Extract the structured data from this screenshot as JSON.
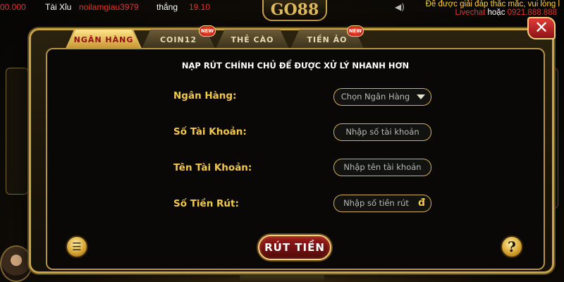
{
  "ticker": {
    "amount": "00.000",
    "game": "Tài Xỉu",
    "user": "noilamgiau3979",
    "word": "thắng",
    "amount2": "19.10"
  },
  "logo": {
    "text": "GO88"
  },
  "support": {
    "help_text": "Để được giải đáp thắc mắc, vui lòng l",
    "livechat": "Livechat",
    "or": " hoặc ",
    "phone": "0921.888.888"
  },
  "modal": {
    "close_label": "✕",
    "tabs": [
      {
        "label": "NGÂN HÀNG",
        "active": true,
        "new": false
      },
      {
        "label": "COIN12",
        "active": false,
        "new": true
      },
      {
        "label": "THẺ CÀO",
        "active": false,
        "new": false
      },
      {
        "label": "TIỀN ẢO",
        "active": false,
        "new": true
      }
    ],
    "new_badge": "NEW",
    "title": "NẠP RÚT CHÍNH CHỦ ĐỂ ĐƯỢC XỬ LÝ NHANH HƠN",
    "fields": {
      "bank": {
        "label": "Ngân Hàng:",
        "value": "Chọn Ngân Hàng"
      },
      "account_number": {
        "label": "Số Tài Khoản:",
        "placeholder": "Nhập số tài  khoản"
      },
      "account_name": {
        "label": "Tên Tài Khoản:",
        "placeholder": "Nhập tên tài khoản"
      },
      "amount": {
        "label": "Số Tiền Rút:",
        "placeholder": "Nhập số tiền rút",
        "currency": "đ"
      }
    },
    "withdraw_button": "RÚT TIỀN",
    "help_glyph": "?",
    "list_glyph": "☰"
  },
  "colors": {
    "accent_gold": "#f1c94a",
    "active_tab_text": "#8e1010",
    "button_red": "#9a1a1a"
  }
}
